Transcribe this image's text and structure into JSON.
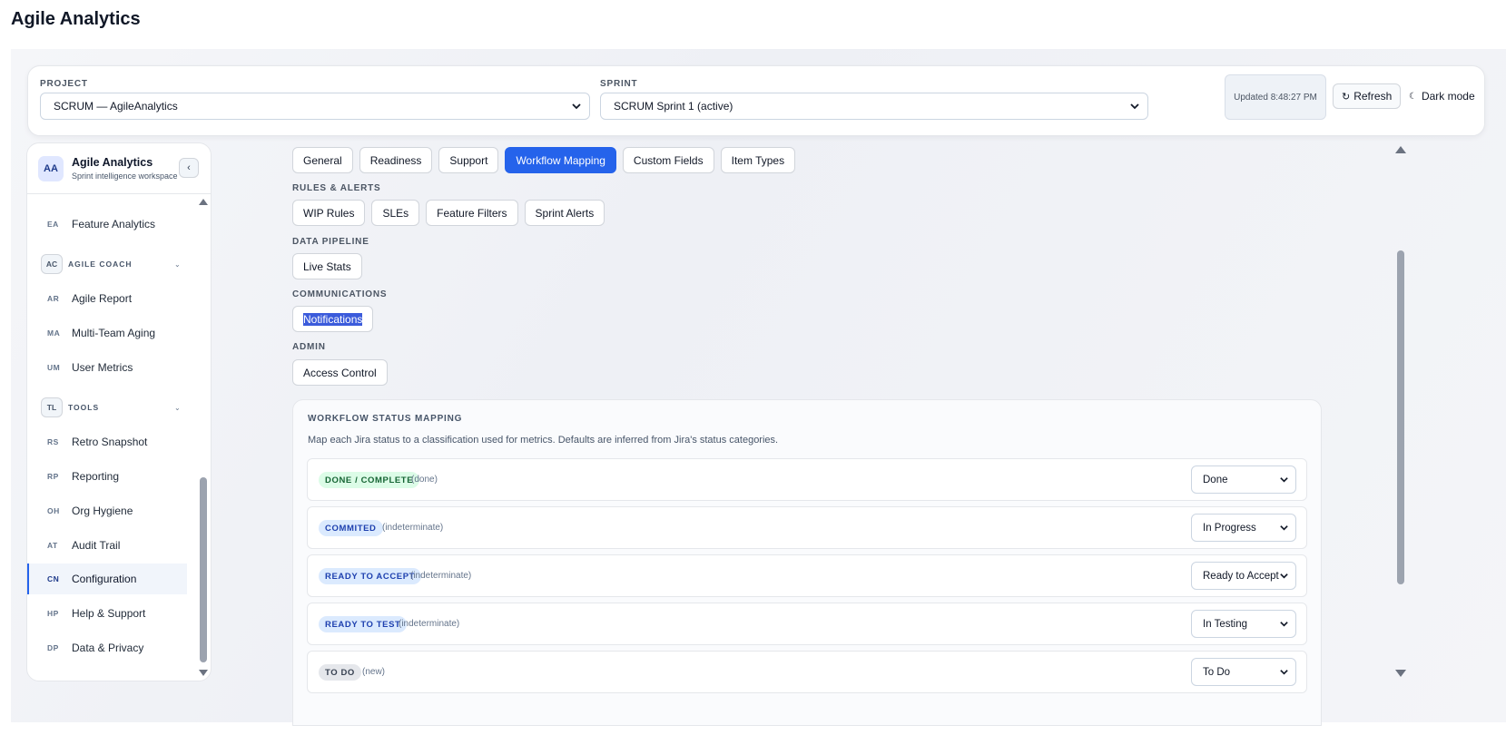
{
  "app": {
    "title": "Agile Analytics"
  },
  "topbar": {
    "project_label": "PROJECT",
    "project_value": "SCRUM — AgileAnalytics",
    "sprint_label": "SPRINT",
    "sprint_value": "SCRUM Sprint 1 (active)",
    "updated": "Updated 8:48:27 PM",
    "refresh_icon": "↻",
    "refresh_label": "Refresh",
    "dark_icon": "☾",
    "dark_label": "Dark mode"
  },
  "sidebar": {
    "avatar": "AA",
    "brand_name": "Agile Analytics",
    "brand_sub": "Sprint intelligence workspace",
    "collapse_icon": "‹",
    "items_top": [
      {
        "code": "EA",
        "label": "Feature Analytics"
      }
    ],
    "group_coach": {
      "badge": "AC",
      "name": "AGILE COACH",
      "chevron": "⌄"
    },
    "items_coach": [
      {
        "code": "AR",
        "label": "Agile Report"
      },
      {
        "code": "MA",
        "label": "Multi-Team Aging"
      },
      {
        "code": "UM",
        "label": "User Metrics"
      }
    ],
    "group_tools": {
      "badge": "TL",
      "name": "TOOLS",
      "chevron": "⌄"
    },
    "items_tools": [
      {
        "code": "RS",
        "label": "Retro Snapshot"
      },
      {
        "code": "RP",
        "label": "Reporting"
      },
      {
        "code": "OH",
        "label": "Org Hygiene"
      },
      {
        "code": "AT",
        "label": "Audit Trail"
      },
      {
        "code": "CN",
        "label": "Configuration"
      },
      {
        "code": "HP",
        "label": "Help & Support"
      },
      {
        "code": "DP",
        "label": "Data & Privacy"
      }
    ]
  },
  "config": {
    "tabs": [
      "General",
      "Readiness",
      "Support",
      "Workflow Mapping",
      "Custom Fields",
      "Item Types"
    ],
    "rules_label": "RULES & ALERTS",
    "rules": [
      "WIP Rules",
      "SLEs",
      "Feature Filters",
      "Sprint Alerts"
    ],
    "pipeline_label": "DATA PIPELINE",
    "pipeline": [
      "Live Stats"
    ],
    "comms_label": "COMMUNICATIONS",
    "comms": [
      "Notifications"
    ],
    "admin_label": "ADMIN",
    "admin": [
      "Access Control"
    ]
  },
  "mapping": {
    "title": "WORKFLOW STATUS MAPPING",
    "description": "Map each Jira status to a classification used for metrics. Defaults are inferred from Jira's status categories.",
    "rows": [
      {
        "status": "DONE / COMPLETE",
        "category": "(done)",
        "value": "Done"
      },
      {
        "status": "COMMITED",
        "category": "(indeterminate)",
        "value": "In Progress"
      },
      {
        "status": "READY TO ACCEPT",
        "category": "(indeterminate)",
        "value": "Ready to Accept"
      },
      {
        "status": "READY TO TEST",
        "category": "(indeterminate)",
        "value": "In Testing"
      },
      {
        "status": "TO DO",
        "category": "(new)",
        "value": "To Do"
      }
    ]
  },
  "colors": {
    "accent": "#2563eb",
    "done_pill": "#dcfce7",
    "indeterminate_pill": "#dbeafe",
    "new_pill": "#e5e7eb"
  }
}
